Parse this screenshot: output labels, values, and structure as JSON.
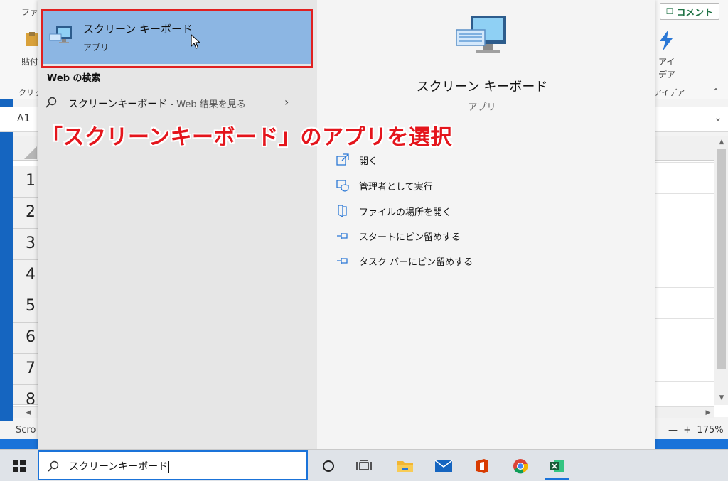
{
  "excel": {
    "ribbon_tab_label": "ファ",
    "paste_label": "貼付",
    "clipboard_group_label": "クリッ",
    "comment_button_label": "コメント",
    "idea_label_line1": "アイ",
    "idea_label_line2": "デア",
    "idea_group_label": "アイデア",
    "name_box": "A1",
    "row_numbers": [
      "1",
      "2",
      "3",
      "4",
      "5",
      "6",
      "7",
      "8"
    ],
    "status_text": "Scro",
    "zoom": "175%"
  },
  "search": {
    "best_match": {
      "title": "スクリーン キーボード",
      "subtitle": "アプリ"
    },
    "web_section_label": "Web の検索",
    "web_result": {
      "query": "スクリーンキーボード",
      "suffix": " - Web 結果を見る"
    },
    "detail": {
      "title": "スクリーン キーボード",
      "type": "アプリ",
      "actions": [
        {
          "label": "開く",
          "icon": "open-icon"
        },
        {
          "label": "管理者として実行",
          "icon": "shield-icon"
        },
        {
          "label": "ファイルの場所を開く",
          "icon": "file-location-icon"
        },
        {
          "label": "スタートにピン留めする",
          "icon": "pin-icon"
        },
        {
          "label": "タスク バーにピン留めする",
          "icon": "pin-icon"
        }
      ]
    }
  },
  "annotation": "「スクリーンキーボード」のアプリを選択",
  "taskbar": {
    "search_query": "スクリーンキーボード",
    "icons": [
      "windows-icon",
      "cortana-icon",
      "task-view-icon",
      "file-explorer-icon",
      "mail-icon",
      "office-icon",
      "chrome-icon",
      "excel-icon"
    ]
  },
  "colors": {
    "highlight_red": "#e02020",
    "selected_blue": "#8cb6e3",
    "accent_blue": "#1a73d9",
    "excel_green": "#217346"
  }
}
